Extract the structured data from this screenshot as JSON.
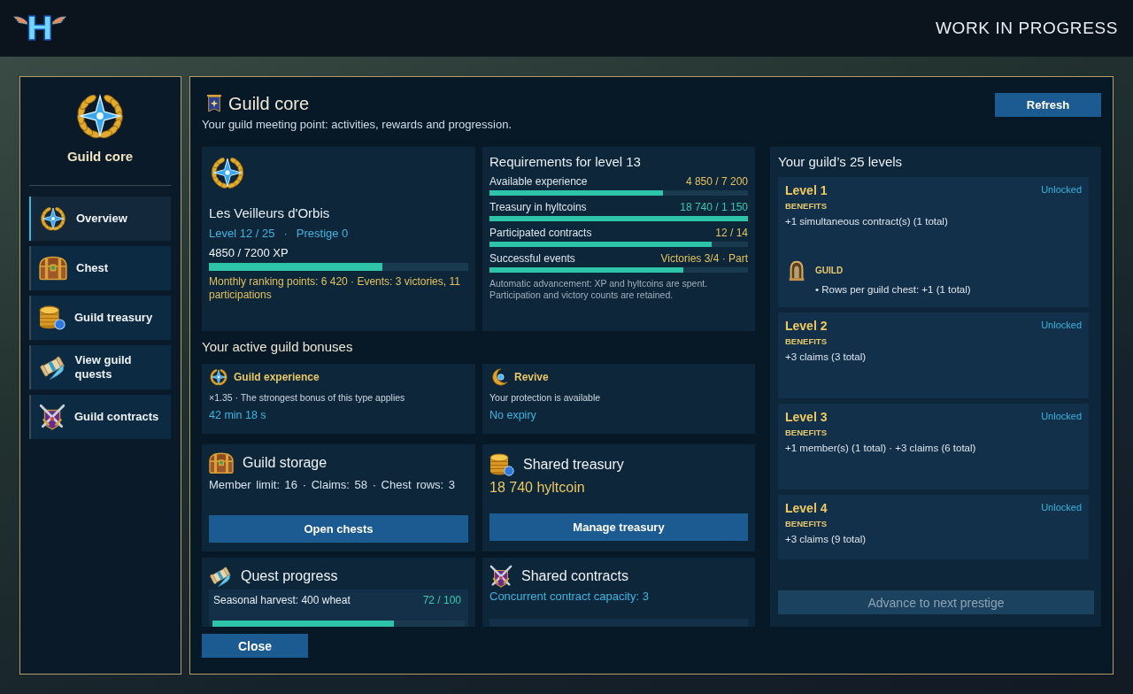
{
  "header": {
    "logo": "H",
    "title": "WORK IN PROGRESS"
  },
  "sidebar": {
    "title": "Guild core",
    "items": [
      {
        "label": "Overview",
        "kind": "overview",
        "selected": true
      },
      {
        "label": "Chest",
        "kind": "chest",
        "selected": false
      },
      {
        "label": "Guild treasury",
        "kind": "treasury",
        "selected": false
      },
      {
        "label": "View guild quests",
        "kind": "quests",
        "selected": false
      },
      {
        "label": "Guild contracts",
        "kind": "contracts",
        "selected": false
      }
    ]
  },
  "page": {
    "title": "Guild core",
    "subtitle": "Your guild meeting point: activities, rewards and progression.",
    "refresh_button": "Refresh",
    "close_button": "Close"
  },
  "guild": {
    "name": "Les Veilleurs d'Orbis",
    "level_text": "Level 12 / 25",
    "separator": "·",
    "prestige": "Prestige 0",
    "xp": "4850 / 7200 XP",
    "xp_bar": {
      "level": 0.67
    },
    "stats": "Monthly ranking points: 6 420 · Events: 3 victories, 11 participations"
  },
  "requirements": {
    "title": "Requirements for level 13",
    "rows": [
      {
        "label": "Available experience",
        "value": "4 850 / 7 200",
        "met": false,
        "level": 0.67
      },
      {
        "label": "Treasury in hyltcoins",
        "value": "18 740 / 1 150",
        "met": true,
        "level": 1
      },
      {
        "label": "Participated contracts",
        "value": "12 / 14",
        "met": false,
        "level": 0.86
      },
      {
        "label": "Successful events",
        "value": "Victories 3/4 · Part",
        "met": false,
        "level": 0.75
      }
    ],
    "note": "Automatic advancement: XP and hyltcoins are spent. Participation and victory counts are retained."
  },
  "bonuses": {
    "title": "Your active guild bonuses",
    "items": [
      {
        "kind": "experience",
        "name": "Guild experience",
        "description": "×1.35 · The strongest bonus of this type applies",
        "duration": "42 min 18 s"
      },
      {
        "kind": "revive",
        "name": "Revive",
        "description": "Your protection is available",
        "duration": "No expiry"
      }
    ]
  },
  "storage": {
    "title": "Guild storage",
    "stats": "Member limit: 16 · Claims: 58 · Chest rows: 3",
    "button": "Open chests"
  },
  "treasury": {
    "title": "Shared treasury",
    "amount": "18 740 hyltcoin",
    "button": "Manage treasury"
  },
  "quest_progress": {
    "title": "Quest progress",
    "rows": [
      {
        "label": "Seasonal harvest: 400 wheat",
        "value": "72 / 100",
        "level": 0.72
      }
    ]
  },
  "contracts": {
    "title": "Shared contracts",
    "capacity": "Concurrent contract capacity: 3"
  },
  "levels": {
    "title": "Your guild’s 25 levels",
    "items": [
      {
        "name": "Level 1",
        "status": "Unlocked",
        "unlocked": true,
        "benefits_label": "BENEFITS",
        "benefits": "+1 simultaneous contract(s) (1 total)",
        "unlocks": [
          {
            "kind": "guild",
            "category": "GUILD",
            "lines": [
              "• Rows per guild chest: +1 (1 total)"
            ]
          }
        ]
      },
      {
        "name": "Level 2",
        "status": "Unlocked",
        "unlocked": true,
        "benefits_label": "BENEFITS",
        "benefits": "+3 claims (3 total)"
      },
      {
        "name": "Level 3",
        "status": "Unlocked",
        "unlocked": true,
        "benefits_label": "BENEFITS",
        "benefits": "+1 member(s) (1 total) · +3 claims (6 total)"
      },
      {
        "name": "Level 4",
        "status": "Unlocked",
        "unlocked": true,
        "benefits_label": "BENEFITS",
        "benefits": "+3 claims (9 total)"
      }
    ],
    "advance_button": {
      "label": "Advance to next prestige",
      "disabled": true
    }
  }
}
